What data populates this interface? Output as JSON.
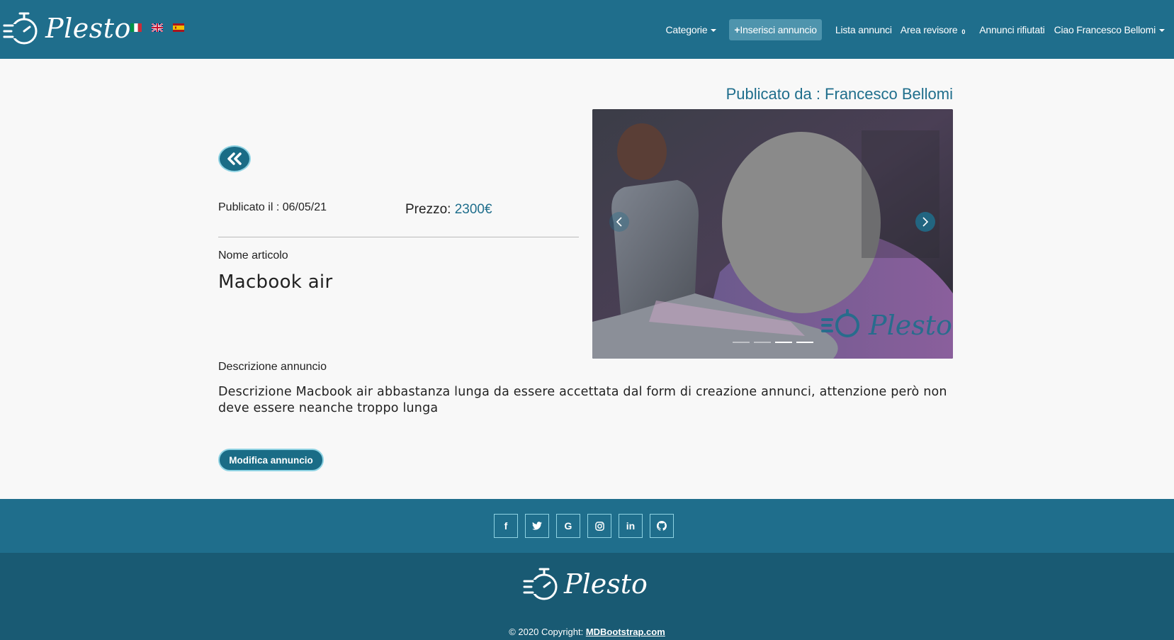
{
  "brand": {
    "name": "Plesto",
    "logo_icon": "stopwatch-lines-icon"
  },
  "languages": [
    {
      "code": "it",
      "icon": "flag-it-icon"
    },
    {
      "code": "en",
      "icon": "flag-uk-icon"
    },
    {
      "code": "es",
      "icon": "flag-es-icon"
    }
  ],
  "nav": {
    "categories": "Categorie",
    "insert_icon": "+",
    "insert": "Inserisci annuncio",
    "list": "Lista annunci",
    "reviewer": "Area revisore",
    "reviewer_badge": "0",
    "rejected": "Annunci rifiutati",
    "user": "Ciao Francesco Bellomi"
  },
  "listing": {
    "published_by": "Publicato da : Francesco Bellomi",
    "published_on": "Publicato il : 06/05/21",
    "price_label": "Prezzo:",
    "price_value": "2300€",
    "name_label": "Nome articolo",
    "name_value": "Macbook air",
    "description_label": "Descrizione annuncio",
    "description_value": "Descrizione Macbook air abbastanza lunga da essere accettata dal form di creazione annunci, attenzione però non deve essere neanche troppo lunga",
    "edit_button": "Modifica annuncio",
    "back_icon": "double-chevron-left-icon"
  },
  "carousel": {
    "watermark": "Plesto",
    "slide_count": 4,
    "active_index": 2
  },
  "footer": {
    "social": [
      {
        "icon": "facebook-icon",
        "glyph": "f"
      },
      {
        "icon": "twitter-icon",
        "glyph": "t"
      },
      {
        "icon": "google-icon",
        "glyph": "G"
      },
      {
        "icon": "instagram-icon",
        "glyph": "◎"
      },
      {
        "icon": "linkedin-icon",
        "glyph": "in"
      },
      {
        "icon": "github-icon",
        "glyph": "◉"
      }
    ],
    "brand": "Plesto",
    "copyright_prefix": "© 2020 Copyright:",
    "copyright_link": "MDBootstrap.com"
  },
  "colors": {
    "primary": "#1f6e8c",
    "footer_dark": "#195a73",
    "accent_border": "#8fd3e3"
  }
}
